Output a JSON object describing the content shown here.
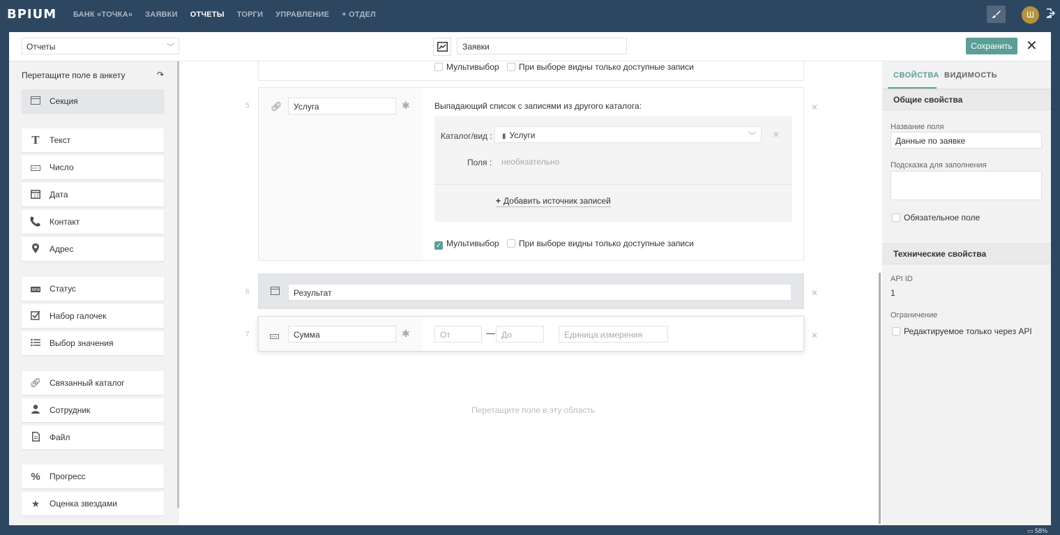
{
  "topbar": {
    "logo": "BPIUM",
    "nav": [
      "БАНК «ТОЧКА»",
      "ЗАЯВКИ",
      "ОТЧЕТЫ",
      "ТОРГИ",
      "УПРАВЛЕНИЕ",
      "+ ОТДЕЛ"
    ],
    "active_nav": "ОТЧЕТЫ",
    "avatar_letter": "Ш"
  },
  "toolbar": {
    "section_select": "Отчеты",
    "catalog_name": "Заявки",
    "save_label": "Сохранить"
  },
  "left": {
    "header": "Перетащите поле в анкету",
    "items": [
      {
        "label": "Секция",
        "icon": "section-icon"
      },
      {
        "label": "Текст",
        "icon": "text-icon"
      },
      {
        "label": "Число",
        "icon": "number-icon"
      },
      {
        "label": "Дата",
        "icon": "calendar-icon"
      },
      {
        "label": "Контакт",
        "icon": "phone-icon"
      },
      {
        "label": "Адрес",
        "icon": "location-pin-icon"
      },
      {
        "label": "Статус",
        "icon": "status-icon"
      },
      {
        "label": "Набор галочек",
        "icon": "checkbox-icon"
      },
      {
        "label": "Выбор значения",
        "icon": "list-icon"
      },
      {
        "label": "Связанный каталог",
        "icon": "link-icon"
      },
      {
        "label": "Сотрудник",
        "icon": "user-icon"
      },
      {
        "label": "Файл",
        "icon": "file-icon"
      },
      {
        "label": "Прогресс",
        "icon": "percent-icon"
      },
      {
        "label": "Оценка звездами",
        "icon": "star-icon"
      }
    ]
  },
  "form": {
    "top_fragment": {
      "multiselect": "Мультивыбор",
      "only_available": "При выборе видны только доступные записи"
    },
    "field5": {
      "num": "5",
      "name": "Услуга",
      "desc": "Выпадающий список с записями из другого каталога:",
      "catalog_label": "Каталог/вид",
      "catalog_value": "Услуги",
      "fields_label": "Поля",
      "fields_placeholder": "необязательно",
      "add_source": "Добавить источник записей",
      "multiselect": "Мультивыбор",
      "only_available": "При выборе видны только доступные записи"
    },
    "field6": {
      "num": "6",
      "name": "Результат"
    },
    "field7": {
      "num": "7",
      "name": "Сумма",
      "from_ph": "От",
      "to_ph": "До",
      "unit_ph": "Единица измерения"
    },
    "drop_hint": "Перетащите поле в эту область"
  },
  "right": {
    "tab_props": "СВОЙСТВА",
    "tab_visibility": "ВИДИМОСТЬ",
    "general_header": "Общие свойства",
    "field_name_label": "Название поля",
    "field_name_value": "Данные по заявке",
    "hint_label": "Подсказка для заполнения",
    "hint_value": "",
    "required_label": "Обязательное поле",
    "tech_header": "Технические свойства",
    "api_id_label": "API ID",
    "api_id_value": "1",
    "restriction_label": "Ограничение",
    "api_only_label": "Редактируемое только через API"
  },
  "statusbar": {
    "battery": "58%"
  },
  "colors": {
    "topbar": "#2e4761",
    "accent": "#5a9e96",
    "avatar": "#b5933e"
  }
}
